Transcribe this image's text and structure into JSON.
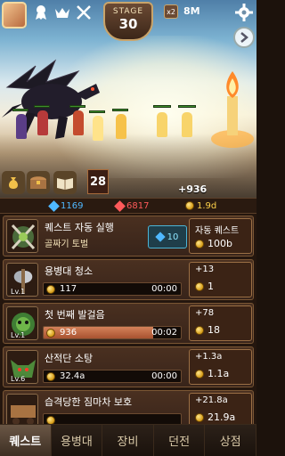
{
  "hud": {
    "stage_label": "STAGE",
    "stage_number": "30",
    "speed_label": "x2",
    "top_currency": "8M",
    "icons": [
      "ribbon-medal-icon",
      "crown-icon",
      "crossed-swords-icon",
      "gear-icon",
      "chevron-right-icon"
    ]
  },
  "battle": {
    "timer_value": "28",
    "damage_per_second": "+936",
    "side_icons": [
      "gold-bag-icon",
      "treasure-chest-icon",
      "spellbook-icon"
    ]
  },
  "currency_strip": {
    "gems": "1169",
    "rubies": "6817",
    "gold": "1.9d",
    "colors": {
      "gem": "#4fb8ff",
      "ruby": "#ff5a5a",
      "gold": "#ffd24a"
    }
  },
  "auto_quest": {
    "title": "퀘스트 자동 실행",
    "subtitle": "골짜기 토벌",
    "gem_cost": "10",
    "reward_label": "자동 퀘스트",
    "reward_value": "100b"
  },
  "quests": [
    {
      "title": "용병대 청소",
      "level": "Lv.1",
      "value": "117",
      "time": "00:00",
      "progress": 0,
      "increment": "+13",
      "reward": "1",
      "icon": "axe-icon"
    },
    {
      "title": "첫 번째 발걸음",
      "level": "Lv.1",
      "value": "936",
      "time": "00:02",
      "progress": 0.8,
      "increment": "+78",
      "reward": "18",
      "icon": "plant-monster-icon"
    },
    {
      "title": "산적단 소탕",
      "level": "Lv.6",
      "value": "32.4a",
      "time": "00:00",
      "progress": 0,
      "increment": "+1.3a",
      "reward": "1.1a",
      "icon": "goblin-icon"
    },
    {
      "title": "습격당한 짐마차 보호",
      "level": "",
      "value": "",
      "time": "",
      "progress": 0,
      "increment": "+21.8a",
      "reward": "21.9a",
      "icon": "wagon-icon"
    }
  ],
  "tabs": [
    {
      "label": "퀘스트",
      "active": true
    },
    {
      "label": "용병대",
      "active": false
    },
    {
      "label": "장비",
      "active": false
    },
    {
      "label": "던전",
      "active": false
    },
    {
      "label": "상점",
      "active": false
    }
  ]
}
